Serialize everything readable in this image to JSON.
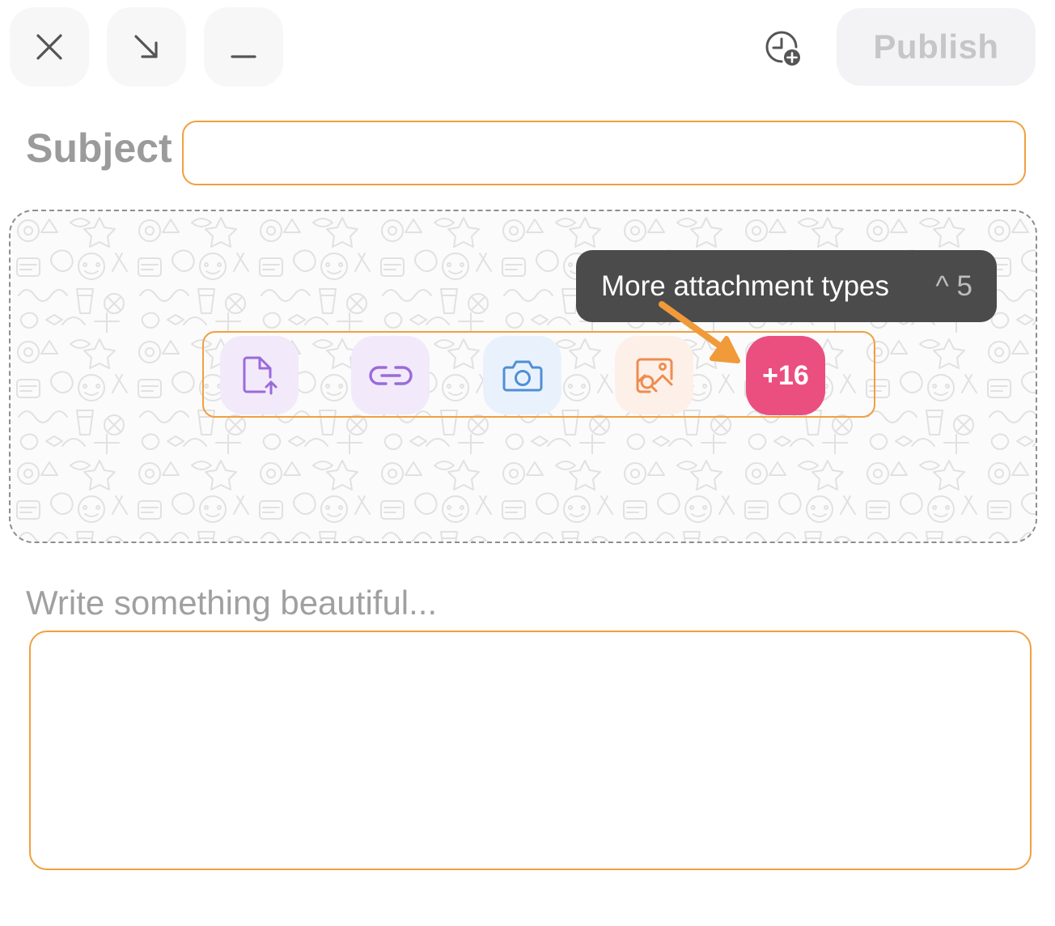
{
  "toolbar": {
    "close_icon": "close-icon",
    "collapse_icon": "arrow-down-right-icon",
    "minimize_icon": "minimize-icon",
    "schedule_icon": "clock-plus-icon",
    "publish_label": "Publish"
  },
  "subject": {
    "label": "Subject",
    "value": ""
  },
  "attachments": {
    "buttons": [
      {
        "icon": "file-upload-icon",
        "color": "#9a6bd8",
        "bg": "#f2e9fb"
      },
      {
        "icon": "link-icon",
        "color": "#9a6bd8",
        "bg": "#f2e9fb"
      },
      {
        "icon": "camera-icon",
        "color": "#4f8fd6",
        "bg": "#e9f2fc"
      },
      {
        "icon": "image-search-icon",
        "color": "#ee8c50",
        "bg": "#fdf0e8"
      }
    ],
    "more_label": "+16",
    "more_color": "#ea4f80",
    "tooltip_text": "More attachment types",
    "tooltip_shortcut": "^ 5"
  },
  "body": {
    "placeholder": "Write something beautiful...",
    "value": ""
  },
  "colors": {
    "highlight": "#f0a040",
    "publish_disabled_text": "#c6c6c9"
  }
}
